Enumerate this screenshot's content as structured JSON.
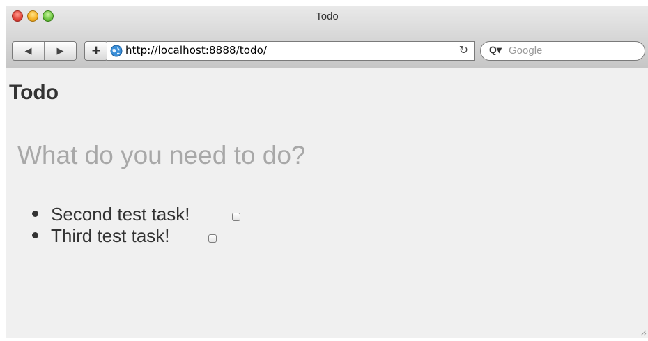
{
  "window": {
    "title": "Todo"
  },
  "toolbar": {
    "back_icon": "back-arrow-icon",
    "forward_icon": "forward-arrow-icon",
    "add_label": "+",
    "url": "http://localhost:8888/todo/",
    "reload_icon": "reload-icon",
    "search_placeholder": "Google"
  },
  "page": {
    "title": "Todo",
    "input_placeholder": "What do you need to do?",
    "tasks": [
      {
        "label": "Second test task!",
        "checked": false
      },
      {
        "label": "Third test task!",
        "checked": false
      }
    ]
  },
  "colors": {
    "page_background": "#f0f0f0",
    "text": "#333333",
    "placeholder": "#a8a8a8"
  }
}
